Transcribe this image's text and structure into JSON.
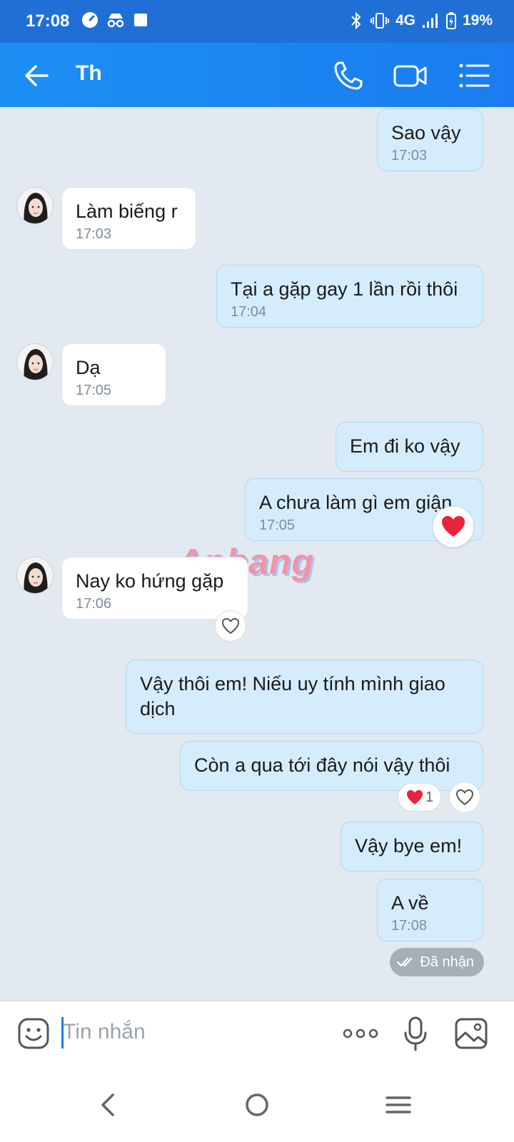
{
  "status_bar": {
    "time": "17:08",
    "network": "4G",
    "battery": "19%",
    "left_icons": [
      "speed-icon",
      "incognito-icon",
      "square-icon"
    ],
    "right_icons": [
      "bluetooth-icon",
      "vibrate-icon",
      "signal-icon",
      "battery-charging-icon"
    ]
  },
  "header": {
    "title": "Th",
    "actions": [
      "phone-icon",
      "video-call-icon",
      "menu-list-icon"
    ],
    "color": "#1a7cf0"
  },
  "messages": [
    {
      "dir": "out",
      "text": "Sao vậy",
      "time": "17:03"
    },
    {
      "dir": "in",
      "text": "Làm biếng r",
      "time": "17:03"
    },
    {
      "dir": "out",
      "text": "Tại a gặp gay 1 lần rồi thôi",
      "time": "17:04"
    },
    {
      "dir": "in",
      "text": "Dạ",
      "time": "17:05"
    },
    {
      "dir": "out",
      "text": "Em đi ko vậy",
      "time": ""
    },
    {
      "dir": "out",
      "text": "A chưa làm gì em giận",
      "time": "17:05",
      "reaction": "heart"
    },
    {
      "dir": "in",
      "text": "Nay ko hứng gặp",
      "time": "17:06",
      "reaction": "heart-outline"
    },
    {
      "dir": "out",
      "text": "Vậy thôi em! Niếu uy tính mình giao\ndịch",
      "time": ""
    },
    {
      "dir": "out",
      "text": "Còn a qua tới đây nói vậy thôi",
      "time": "",
      "reaction_count": "1"
    },
    {
      "dir": "out",
      "text": "Vậy bye em!",
      "time": ""
    },
    {
      "dir": "out",
      "text": "A về",
      "time": "17:08"
    }
  ],
  "delivery_status": "Đã nhận",
  "watermark": "Aphang",
  "input": {
    "placeholder": "Tin nhắn"
  },
  "nav": [
    "back-icon",
    "home-icon",
    "recents-icon"
  ]
}
